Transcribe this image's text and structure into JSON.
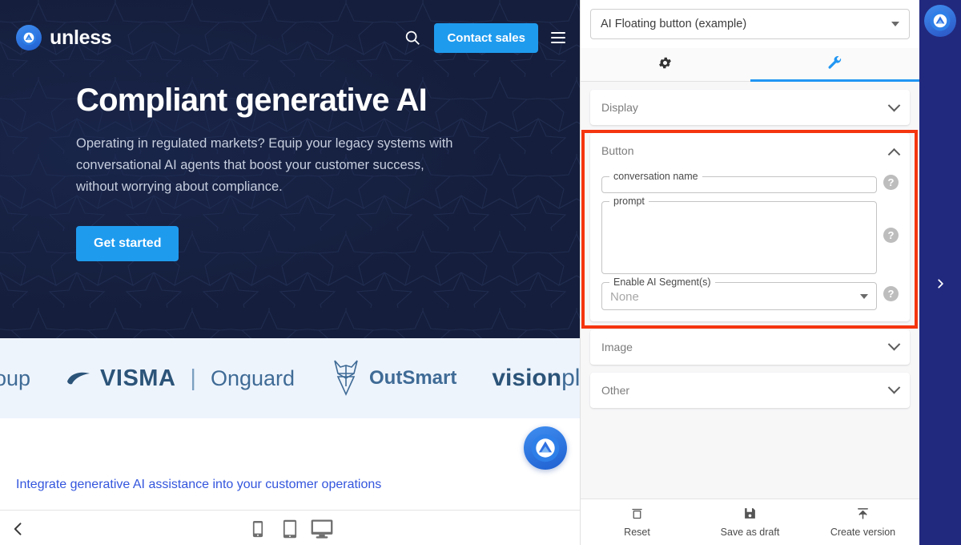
{
  "preview": {
    "nav": {
      "brand_name": "unless",
      "brand_logo_icon": "unless-logo-icon",
      "search_icon": "search-icon",
      "contact_label": "Contact sales",
      "menu_icon": "hamburger-menu-icon"
    },
    "hero": {
      "title": "Compliant generative AI",
      "subtitle": "Operating in regulated markets? Equip your legacy systems with conversational AI agents that boost your customer success, without worrying about compliance.",
      "cta_label": "Get started"
    },
    "logos": [
      {
        "text": "roup",
        "kind": "text"
      },
      {
        "text": "VISMA",
        "kind": "visma"
      },
      {
        "text": "Onguard",
        "kind": "onguard"
      },
      {
        "text": "OutSmart",
        "kind": "outsmart"
      },
      {
        "text": "visionpla",
        "kind": "visionplanner"
      }
    ],
    "lower_heading": "Integrate generative AI assistance into your customer operations",
    "floating_button_icon": "ai-floating-button-icon",
    "device_bar": {
      "back_icon": "chevron-left-icon",
      "devices": [
        {
          "icon": "mobile-icon",
          "label": "Mobile"
        },
        {
          "icon": "tablet-icon",
          "label": "Tablet"
        },
        {
          "icon": "desktop-icon",
          "label": "Desktop"
        }
      ]
    }
  },
  "panel": {
    "component_select": {
      "value": "AI Floating button (example)",
      "caret_icon": "chevron-down-icon"
    },
    "tabs": [
      {
        "icon": "gear-icon",
        "name": "settings",
        "active": false
      },
      {
        "icon": "wrench-icon",
        "name": "tools",
        "active": true
      }
    ],
    "sections": [
      {
        "title": "Display",
        "expanded": false,
        "chevron_icon": "chevron-down-icon"
      },
      {
        "title": "Button",
        "expanded": true,
        "chevron_icon": "chevron-up-icon"
      },
      {
        "title": "Image",
        "expanded": false,
        "chevron_icon": "chevron-down-icon"
      },
      {
        "title": "Other",
        "expanded": false,
        "chevron_icon": "chevron-down-icon"
      }
    ],
    "button_fields": {
      "conversation_name": {
        "label": "conversation name",
        "value": "",
        "help_icon": "help-icon"
      },
      "prompt": {
        "label": "prompt",
        "value": "",
        "help_icon": "help-icon"
      },
      "segments": {
        "label": "Enable AI Segment(s)",
        "value": "None",
        "help_icon": "help-icon",
        "caret_icon": "chevron-down-icon"
      }
    },
    "footer": [
      {
        "label": "Reset",
        "icon": "trash-icon"
      },
      {
        "label": "Save as draft",
        "icon": "save-icon"
      },
      {
        "label": "Create version",
        "icon": "upload-icon"
      }
    ]
  },
  "rail": {
    "logo_icon": "unless-logo-icon",
    "expand_icon": "chevron-right-icon"
  },
  "colors": {
    "accent_blue": "#2196f3",
    "brand_blue": "#1f9bee",
    "navy": "#21297e",
    "hero_navy": "#151e3c",
    "highlight_red": "#f4350f",
    "link_blue": "#3355dd"
  }
}
